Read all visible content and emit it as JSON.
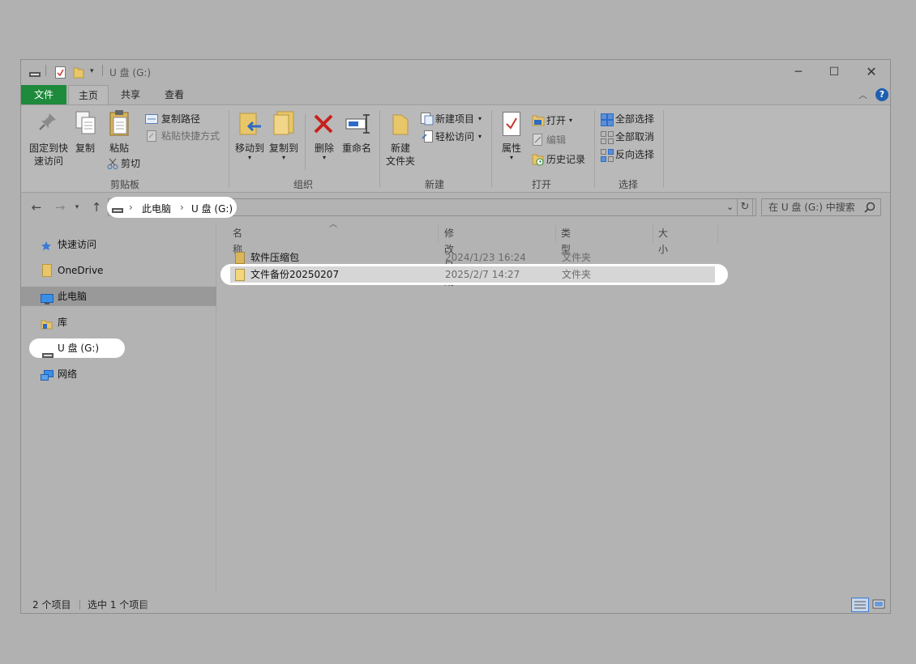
{
  "window": {
    "title": "U 盘 (G:)"
  },
  "ribbon_tabs": {
    "file": "文件",
    "home": "主页",
    "share": "共享",
    "view": "查看"
  },
  "ribbon": {
    "clipboard": {
      "pin_quick_access_line1": "固定到快",
      "pin_quick_access_line2": "速访问",
      "copy": "复制",
      "paste": "粘贴",
      "copy_path": "复制路径",
      "paste_shortcut": "粘贴快捷方式",
      "cut": "剪切",
      "group": "剪贴板"
    },
    "organize": {
      "move_to": "移动到",
      "copy_to": "复制到",
      "delete": "删除",
      "rename": "重命名",
      "group": "组织"
    },
    "new": {
      "new_folder_line1": "新建",
      "new_folder_line2": "文件夹",
      "new_item": "新建项目",
      "easy_access": "轻松访问",
      "group": "新建"
    },
    "open": {
      "properties": "属性",
      "open": "打开",
      "edit": "编辑",
      "history": "历史记录",
      "group": "打开"
    },
    "select": {
      "select_all": "全部选择",
      "select_none": "全部取消",
      "invert": "反向选择",
      "group": "选择"
    }
  },
  "address_bar": {
    "crumbs": [
      "此电脑",
      "U 盘 (G:)"
    ],
    "search_placeholder": "在 U 盘 (G:) 中搜索"
  },
  "sidebar": {
    "items": [
      {
        "label": "快速访问",
        "icon": "star-icon"
      },
      {
        "label": "OneDrive",
        "icon": "folder-icon"
      },
      {
        "label": "此电脑",
        "icon": "computer-icon"
      },
      {
        "label": "库",
        "icon": "library-icon"
      },
      {
        "label": "U 盘 (G:)",
        "icon": "drive-icon"
      },
      {
        "label": "网络",
        "icon": "network-icon"
      }
    ]
  },
  "file_list": {
    "columns": [
      "名称",
      "修改日期",
      "类型",
      "大小"
    ],
    "rows": [
      {
        "name": "软件压缩包",
        "date": "2024/1/23 16:24",
        "type": "文件夹"
      },
      {
        "name": "文件备份20250207",
        "date": "2025/2/7 14:27",
        "type": "文件夹"
      }
    ]
  },
  "status_bar": {
    "item_count": "2 个项目",
    "selected_count": "选中 1 个项目"
  },
  "colors": {
    "file_tab": "#1e8a3c",
    "highlight": "#ffffff",
    "folder": "#e8c66a"
  }
}
